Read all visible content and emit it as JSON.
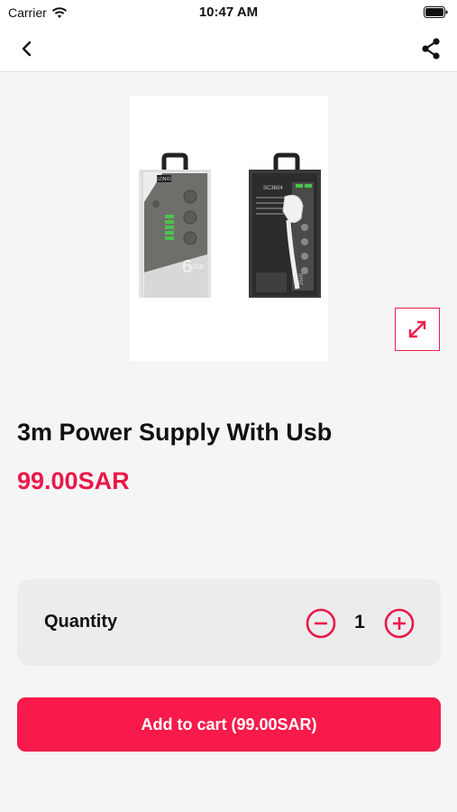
{
  "status_bar": {
    "carrier": "Carrier",
    "time": "10:47 AM",
    "icons": [
      "wifi-icon",
      "battery-icon"
    ]
  },
  "nav": {
    "back_icon": "chevron-left-icon",
    "share_icon": "share-icon"
  },
  "product": {
    "title": "3m Power Supply With Usb",
    "price": "99.00SAR",
    "expand_icon": "expand-icon",
    "image_printed_text": [
      "LDNIO",
      "6",
      "USB",
      "SC3604",
      "2500"
    ]
  },
  "quantity": {
    "label": "Quantity",
    "value": "1",
    "decrement_icon": "minus-circle-icon",
    "increment_icon": "plus-circle-icon"
  },
  "cart": {
    "button_label": "Add to cart (99.00SAR)"
  },
  "colors": {
    "accent": "#f71a4a",
    "price": "#ea1848",
    "background": "#f5f5f6",
    "card": "#ececef"
  }
}
